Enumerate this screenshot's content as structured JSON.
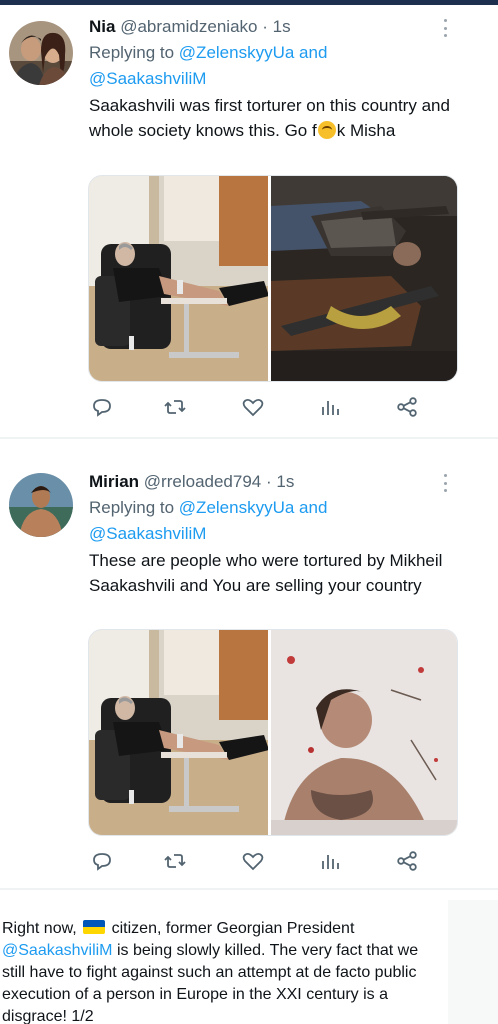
{
  "tweets": [
    {
      "name": "Nia",
      "handle": "@abramidzeniako",
      "time": "1s",
      "reply_prefix": "Replying to",
      "reply_to_1": "@ZelenskyyUa",
      "reply_and": "and",
      "reply_to_2": "@SaakashviliM",
      "text_part1": "Saakashvili was first torturer on this country and whole society knows this. Go f",
      "text_part2": "k Misha"
    },
    {
      "name": "Mirian",
      "handle": "@rreloaded794",
      "time": "1s",
      "reply_prefix": "Replying to",
      "reply_to_1": "@ZelenskyyUa",
      "reply_and": "and",
      "reply_to_2": "@SaakashviliM",
      "text": "These are people who were tortured by Mikheil Saakashvili and You are selling your country"
    }
  ],
  "bottom_post": {
    "part1": "Right now,",
    "part2": "citizen, former Georgian President",
    "mention": "@SaakashviliM",
    "part3": "is being slowly killed. The very fact that we still have to fight against such an attempt at de facto public execution of a person in Europe in the XXI century is a disgrace! 1/2"
  },
  "icons": [
    "more-icon",
    "reply-icon",
    "retweet-icon",
    "like-icon",
    "views-icon",
    "share-icon"
  ],
  "colors": {
    "accent": "#1d9bf0",
    "muted": "#536471",
    "text": "#0f1419",
    "topbar": "#1d2f4f",
    "flag_blue": "#0057b7",
    "flag_yellow": "#ffd700"
  }
}
